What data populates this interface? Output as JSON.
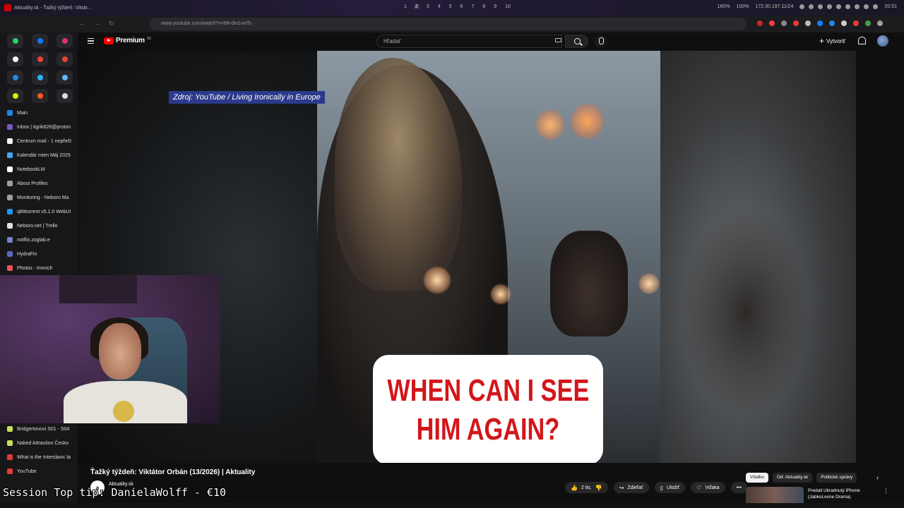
{
  "os_bar": {
    "window_title": "Aktuality.sk - Ťažký týždeň: Viktát…",
    "workspaces": [
      "1",
      "2",
      "3",
      "4",
      "5",
      "6",
      "7",
      "8",
      "9",
      "10"
    ],
    "active_workspace": "2",
    "zoom": "160%",
    "volume": "100%",
    "ip": "172.30.197.11/24",
    "clock": "20:51"
  },
  "browser": {
    "url": "www.youtube.com/watch?v=tW-dtv1vwTs",
    "extension_colors": [
      "#c62828",
      "#ff3b3b",
      "#888888",
      "#e53935",
      "#bbbbbb",
      "#0a84ff",
      "#1e88e5",
      "#cccccc",
      "#e53935",
      "#43a047",
      "#9e9e9e"
    ]
  },
  "sidebar": {
    "pinned": [
      {
        "icon": "whatsapp-icon",
        "color": "#25d366"
      },
      {
        "icon": "messenger-icon",
        "color": "#0a7cff"
      },
      {
        "icon": "instagram-icon",
        "color": "#e1306c"
      },
      {
        "icon": "x-icon",
        "color": "#ffffff"
      },
      {
        "icon": "gmail-icon",
        "color": "#ea4335"
      },
      {
        "icon": "gmail-icon",
        "color": "#ea4335"
      },
      {
        "icon": "chat-icon",
        "color": "#1e88e5"
      },
      {
        "icon": "drop-icon",
        "color": "#29b6f6"
      },
      {
        "icon": "window-icon",
        "color": "#64b5f6"
      },
      {
        "icon": "app-icon",
        "color": "#c6ff00"
      },
      {
        "icon": "brave-icon",
        "color": "#ff5722"
      },
      {
        "icon": "circle-icon",
        "color": "#dddddd"
      }
    ],
    "tabs": [
      {
        "label": "Main",
        "color": "#1e88e5"
      },
      {
        "label": "Inbox | tigrik626@proton",
        "color": "#7e57c2"
      },
      {
        "label": "Centrum mail - 1 nepřečt",
        "color": "#f4f4f4"
      },
      {
        "label": "Kalendár mien Máj 2025",
        "color": "#42a5f5"
      },
      {
        "label": "NotebookLM",
        "color": "#ffffff"
      },
      {
        "label": "About Profiles",
        "color": "#9e9e9e"
      },
      {
        "label": "Monitoring - Neboro Ma",
        "color": "#9e9e9e"
      },
      {
        "label": "qBittorrent v5.1.0 WebUI",
        "color": "#2196f3"
      },
      {
        "label": "Neboro.net | Trello",
        "color": "#e0e0e0"
      },
      {
        "label": "notflix.zoglab.e",
        "color": "#7986cb"
      },
      {
        "label": "HydraFin",
        "color": "#5c6bc0"
      },
      {
        "label": "Photos - Immich",
        "color": "#ef5350"
      }
    ],
    "tabs_bottom": [
      {
        "label": "Bridgertonovi S01 - S04",
        "color": "#c6e05a"
      },
      {
        "label": "Naked Attraction Česko",
        "color": "#c6e05a"
      },
      {
        "label": "What is the Interslavic la",
        "color": "#e53935"
      },
      {
        "label": "YouTube",
        "color": "#e53935"
      }
    ]
  },
  "youtube": {
    "logo_text": "Premium",
    "logo_sup": "SK",
    "search_placeholder": "Hľadať",
    "create_label": "Vytvoriť"
  },
  "video": {
    "source_label": "Zdroj: YouTube / Living Ironically in Europe",
    "caption_line1": "WHEN CAN I SEE",
    "caption_line2": "HIM AGAIN?"
  },
  "below": {
    "title": "Ťažký týždeň: Viktátor Orbán (13/2026) | Aktuality",
    "channel_avatar": "a",
    "channel_name": "Aktuality.sk",
    "likes": "2 tis.",
    "share": "Zdieľať",
    "save": "Uložiť",
    "thanks": "Vďaka",
    "more": "•••",
    "chips": [
      "Všetko",
      "Od: Aktuality.sk",
      "Politické správy"
    ],
    "active_chip": "Všetko",
    "rec_title_1": "Predali Ukradnutý iPhone",
    "rec_title_2": "(JabkoLevne Drama)"
  },
  "stream_tip": "Session Top tip: DanielaWolff - €10"
}
